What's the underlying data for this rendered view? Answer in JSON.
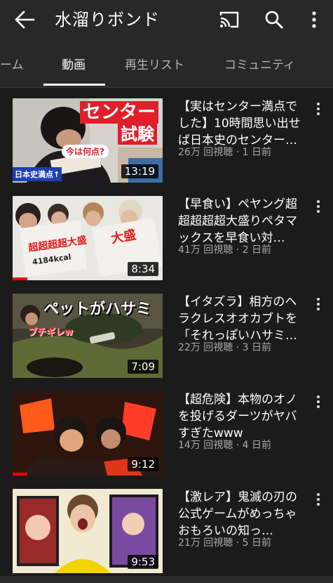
{
  "header": {
    "title": "水溜りボンド",
    "back_icon": "arrow-left-icon",
    "cast_icon": "cast-icon",
    "search_icon": "search-icon",
    "more_icon": "more-vertical-icon"
  },
  "tabs": [
    {
      "label": "ーム",
      "active": false
    },
    {
      "label": "動画",
      "active": true
    },
    {
      "label": "再生リスト",
      "active": false
    },
    {
      "label": "コミュニティ",
      "active": false
    }
  ],
  "videos": [
    {
      "title": "【実はセンター満点でした】10時間思い出せば日本史のセンター…",
      "meta": "26万 回視聴 · 1 日前",
      "duration": "13:19",
      "thumb_text": {
        "line1": "センター",
        "line2": "試験",
        "bubble": "今は何点?",
        "tag": "日本史満点↑"
      },
      "watched": 0.0
    },
    {
      "title": "【早食い】ペヤング超超超超超大盛りペタマックスを早食い対…",
      "meta": "41万 回視聴 · 2 日前",
      "duration": "8:34",
      "thumb_text": {
        "box1": "超超超超大盛",
        "box2": "4184kcal",
        "box3": "大盛"
      },
      "watched": 0.1
    },
    {
      "title": "【イタズラ】相方のヘラクレスオオカブトを「それっぽいハサミ…",
      "meta": "22万 回視聴 · 3 日前",
      "duration": "7:09",
      "thumb_text": {
        "line1": "ペットがハサミ",
        "tag": "ブチギレw"
      },
      "watched": 0.0
    },
    {
      "title": "【超危険】本物のオノを投げるダーツがヤバすぎたwww",
      "meta": "14万 回視聴 · 4 日前",
      "duration": "9:12",
      "thumb_text": {},
      "watched": 0.1
    },
    {
      "title": "【激レア】鬼滅の刃の公式ゲームがめっちゃおもろいの知っ…",
      "meta": "21万 回視聴 · 5 日前",
      "duration": "9:53",
      "thumb_text": {},
      "watched": 0.0
    }
  ],
  "colors": {
    "background": "#1b1b1b",
    "header": "#282828",
    "text": "#ffffff",
    "meta": "#aaaaaa",
    "progress": "#ff0000"
  }
}
